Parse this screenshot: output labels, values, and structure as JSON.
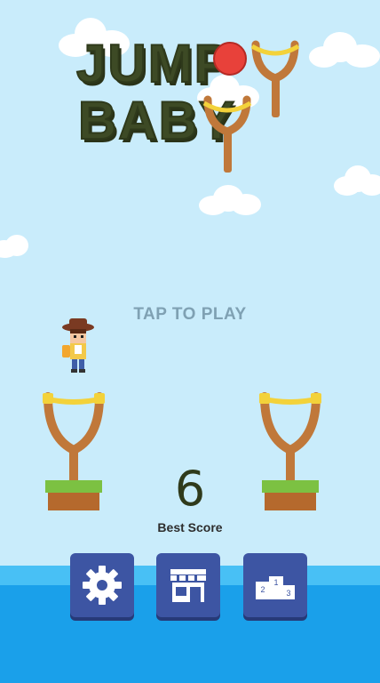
{
  "game": {
    "title_line1": "JUMP",
    "title_line2": "BABY",
    "prompt": "TAP TO PLAY",
    "best_score_value": "6",
    "best_score_label": "Best Score"
  },
  "buttons": [
    {
      "name": "settings-button",
      "icon": "gear-icon"
    },
    {
      "name": "shop-button",
      "icon": "shop-icon"
    },
    {
      "name": "leaderboard-button",
      "icon": "podium-icon",
      "podium_labels": [
        "2",
        "1",
        "3"
      ]
    }
  ],
  "colors": {
    "sky": "#c9ecfb",
    "water": "#1aa0ea",
    "button": "#3d55a3",
    "title": "#3d4a25",
    "slingshot_wood": "#c0783a",
    "slingshot_band": "#f3d23a",
    "grass": "#7cc142",
    "dirt": "#b5692d",
    "ball": "#e8413a"
  }
}
